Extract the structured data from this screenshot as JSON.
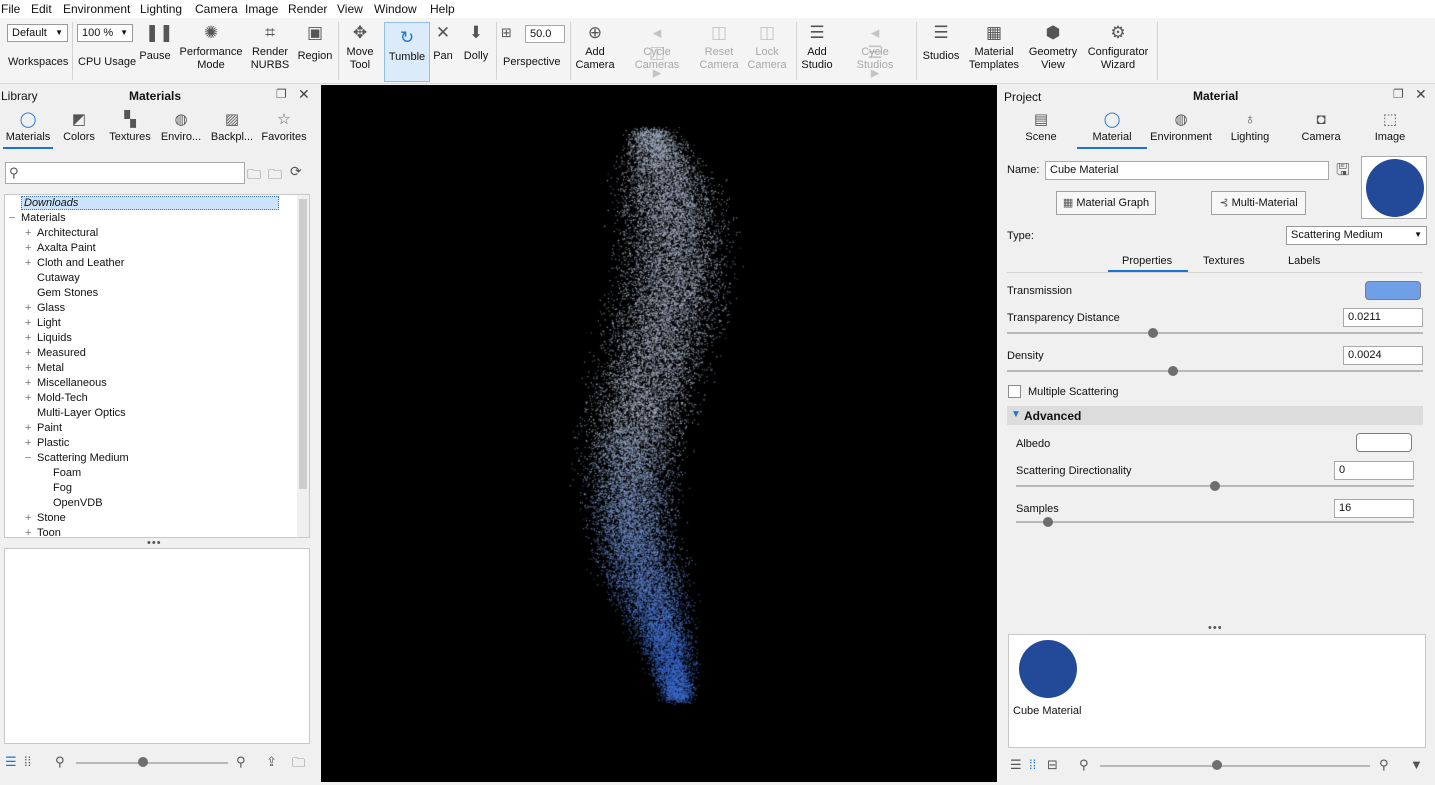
{
  "menu": [
    "File",
    "Edit",
    "Environment",
    "Lighting",
    "Camera",
    "Image",
    "Render",
    "View",
    "Window",
    "Help"
  ],
  "toolbar": {
    "workspace_value": "Default",
    "workspaces_label": "Workspaces",
    "zoom_value": "100 %",
    "cpu_usage": "CPU Usage",
    "pause": "Pause",
    "performance_mode_1": "Performance",
    "performance_mode_2": "Mode",
    "render_nurbs_1": "Render",
    "render_nurbs_2": "NURBS",
    "region": "Region",
    "move_tool_1": "Move",
    "move_tool_2": "Tool",
    "tumble": "Tumble",
    "pan": "Pan",
    "dolly": "Dolly",
    "fov_value": "50.0",
    "perspective": "Perspective",
    "add_camera_1": "Add",
    "add_camera_2": "Camera",
    "cycle_cameras_1": "Cycle",
    "cycle_cameras_2": "Cameras",
    "reset_camera_1": "Reset",
    "reset_camera_2": "Camera",
    "lock_camera_1": "Lock",
    "lock_camera_2": "Camera",
    "add_studio_1": "Add",
    "add_studio_2": "Studio",
    "cycle_studios_1": "Cycle",
    "cycle_studios_2": "Studios",
    "studios": "Studios",
    "material_templates_1": "Material",
    "material_templates_2": "Templates",
    "geometry_view_1": "Geometry",
    "geometry_view_2": "View",
    "configurator_wizard_1": "Configurator",
    "configurator_wizard_2": "Wizard"
  },
  "library": {
    "panel_label": "Library",
    "title": "Materials",
    "tabs": [
      "Materials",
      "Colors",
      "Textures",
      "Enviro...",
      "Backpl...",
      "Favorites"
    ],
    "search_placeholder": "",
    "tree": [
      {
        "label": "Downloads",
        "level": 0,
        "selected": true
      },
      {
        "label": "Materials",
        "level": 0,
        "expander": "−"
      },
      {
        "label": "Architectural",
        "level": 1,
        "expander": "+"
      },
      {
        "label": "Axalta Paint",
        "level": 1,
        "expander": "+"
      },
      {
        "label": "Cloth and Leather",
        "level": 1,
        "expander": "+"
      },
      {
        "label": "Cutaway",
        "level": 1,
        "expander": ""
      },
      {
        "label": "Gem Stones",
        "level": 1,
        "expander": ""
      },
      {
        "label": "Glass",
        "level": 1,
        "expander": "+"
      },
      {
        "label": "Light",
        "level": 1,
        "expander": "+"
      },
      {
        "label": "Liquids",
        "level": 1,
        "expander": "+"
      },
      {
        "label": "Measured",
        "level": 1,
        "expander": "+"
      },
      {
        "label": "Metal",
        "level": 1,
        "expander": "+"
      },
      {
        "label": "Miscellaneous",
        "level": 1,
        "expander": "+"
      },
      {
        "label": "Mold-Tech",
        "level": 1,
        "expander": "+"
      },
      {
        "label": "Multi-Layer Optics",
        "level": 1,
        "expander": ""
      },
      {
        "label": "Paint",
        "level": 1,
        "expander": "+"
      },
      {
        "label": "Plastic",
        "level": 1,
        "expander": "+"
      },
      {
        "label": "Scattering Medium",
        "level": 1,
        "expander": "−"
      },
      {
        "label": "Foam",
        "level": 2,
        "expander": ""
      },
      {
        "label": "Fog",
        "level": 2,
        "expander": ""
      },
      {
        "label": "OpenVDB",
        "level": 2,
        "expander": ""
      },
      {
        "label": "Stone",
        "level": 1,
        "expander": "+"
      },
      {
        "label": "Toon",
        "level": 1,
        "expander": "+"
      }
    ]
  },
  "project": {
    "panel_label": "Project",
    "title": "Material",
    "tabs": [
      "Scene",
      "Material",
      "Environment",
      "Lighting",
      "Camera",
      "Image"
    ],
    "name_label": "Name:",
    "name_value": "Cube Material",
    "material_graph": "Material Graph",
    "multi_material": "Multi-Material",
    "type_label": "Type:",
    "type_value": "Scattering Medium",
    "subtabs": [
      "Properties",
      "Textures",
      "Labels"
    ],
    "transmission_label": "Transmission",
    "transmission_color": "#6f9fe6",
    "transparency_label": "Transparency Distance",
    "transparency_value": "0.0211",
    "transparency_level": 0.35,
    "density_label": "Density",
    "density_value": "0.0024",
    "density_level": 0.4,
    "multiple_scattering": "Multiple Scattering",
    "advanced": "Advanced",
    "albedo_label": "Albedo",
    "albedo_color": "#ffffff",
    "directionality_label": "Scattering Directionality",
    "directionality_value": "0",
    "directionality_level": 0.5,
    "samples_label": "Samples",
    "samples_value": "16",
    "samples_level": 0.08,
    "preview_color": "#234a98",
    "thumbnail_label": "Cube Material"
  },
  "colors": {
    "accent": "#1a73d9",
    "viewport_bg": "#000000",
    "smoke_light": "#a9b4c8",
    "smoke_blue": "#3d6cd1"
  }
}
